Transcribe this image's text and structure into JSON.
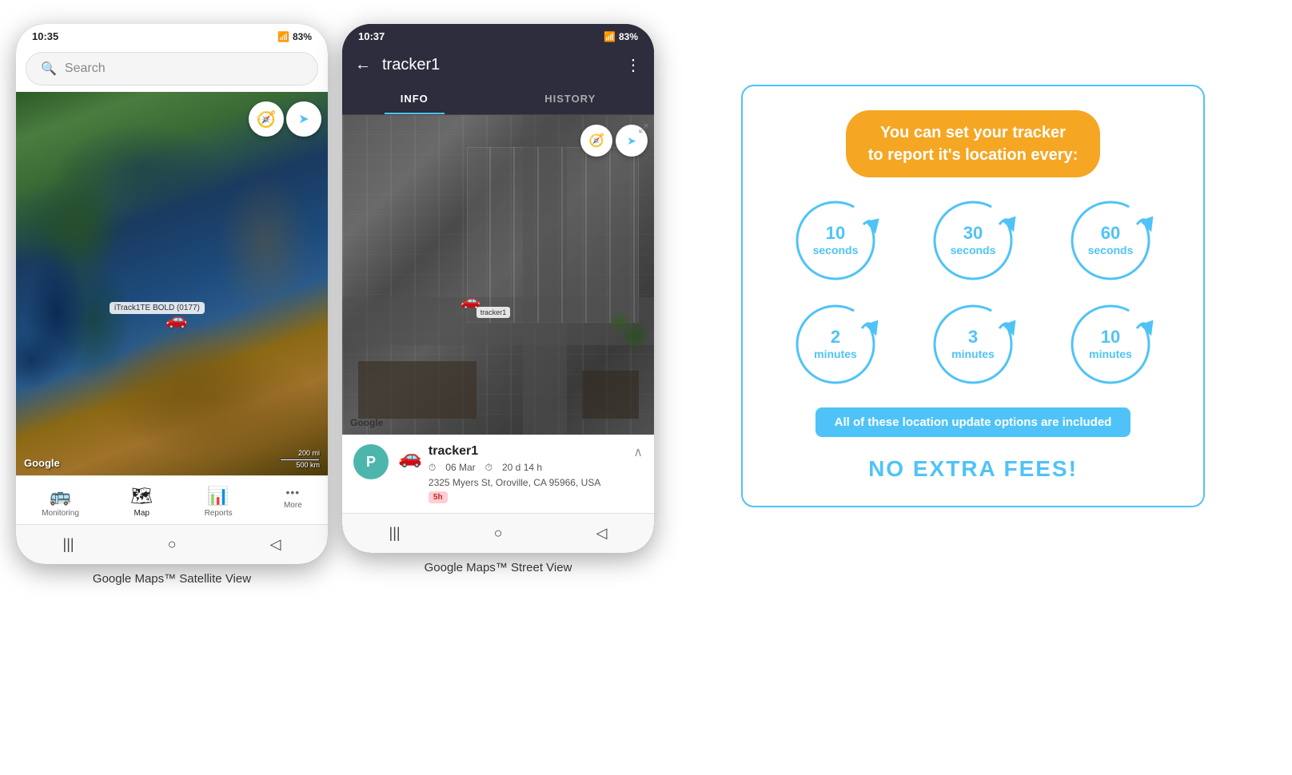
{
  "phone1": {
    "status_bar": {
      "time": "10:35",
      "battery": "83%",
      "signal": "▲▲▲",
      "wifi": "WiFi"
    },
    "search": {
      "placeholder": "Search"
    },
    "map": {
      "tracker_label": "iTrack1TE BOLD (0177)",
      "watermark": "Google",
      "scale_top": "200 mi",
      "scale_bottom": "500 km"
    },
    "nav_items": [
      {
        "label": "Monitoring",
        "icon": "🚌",
        "active": false
      },
      {
        "label": "Map",
        "icon": "🗺",
        "active": true
      },
      {
        "label": "Reports",
        "icon": "📊",
        "active": false
      },
      {
        "label": "More",
        "icon": "···",
        "active": false
      }
    ],
    "caption": "Google Maps™ Satellite View"
  },
  "phone2": {
    "status_bar": {
      "time": "10:37",
      "battery": "83%",
      "signal": "▲▲▲"
    },
    "header": {
      "back_icon": "←",
      "title": "tracker1",
      "more_icon": "⋮"
    },
    "tabs": [
      {
        "label": "INFO",
        "active": true
      },
      {
        "label": "HISTORY",
        "active": false
      }
    ],
    "map": {
      "watermark": "Google",
      "tracker_label": "tracker1"
    },
    "tracker_info": {
      "avatar_letter": "P",
      "device_icon": "🚗",
      "name": "tracker1",
      "date": "06 Mar",
      "duration": "20 d 14 h",
      "address": "2325 Myers St, Oroville, CA 95966, USA",
      "badge": "5h"
    },
    "caption": "Google Maps™ Street View"
  },
  "info_graphic": {
    "headline": "You can set your tracker\nto report it's location every:",
    "intervals": [
      {
        "value": "10",
        "unit": "seconds"
      },
      {
        "value": "30",
        "unit": "seconds"
      },
      {
        "value": "60",
        "unit": "seconds"
      },
      {
        "value": "2",
        "unit": "minutes"
      },
      {
        "value": "3",
        "unit": "minutes"
      },
      {
        "value": "10",
        "unit": "minutes"
      }
    ],
    "banner_text": "All of these location update options are included",
    "no_fees_text": "NO EXTRA FEES!"
  },
  "icons": {
    "compass": "🧭",
    "navigate": "➤",
    "car_pin": "🚗",
    "back": "←",
    "more": "⋮",
    "search": "🔍"
  }
}
